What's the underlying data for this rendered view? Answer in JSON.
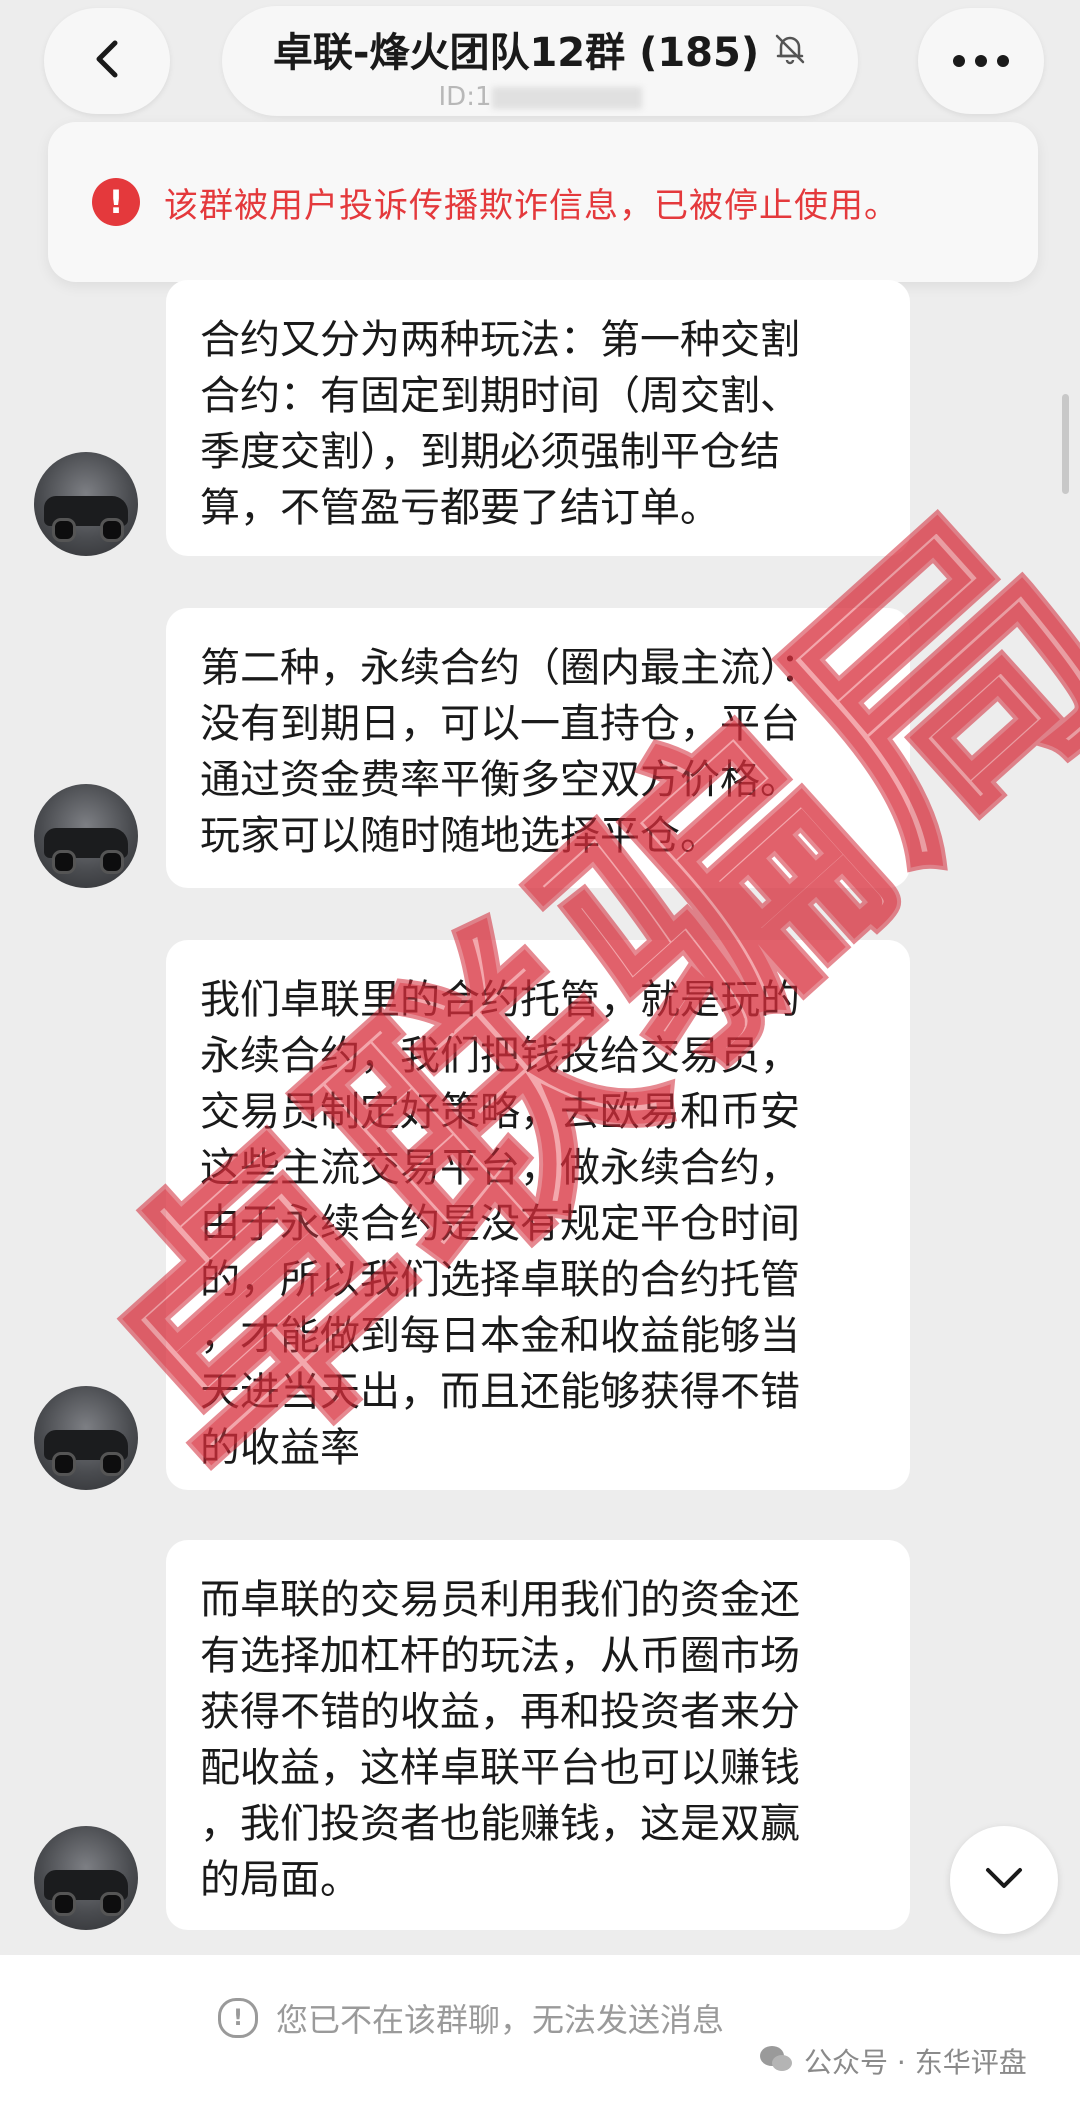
{
  "header": {
    "title": "卓联-烽火团队12群 (185)",
    "id_label": "ID:1",
    "back_icon": "chevron-left-icon",
    "mute_icon": "bell-off-icon",
    "more_icon": "more-horizontal-icon"
  },
  "warning": {
    "icon": "!",
    "text": "该群被用户投诉传播欺诈信息，已被停止使用。",
    "color": "#e4393c"
  },
  "messages": [
    {
      "lines": [
        "合约又分为两种玩法：第一种交割",
        "合约：有固定到期时间（周交割、",
        "季度交割），到期必须强制平仓结",
        "算，不管盈亏都要了结订单。"
      ]
    },
    {
      "lines": [
        "第二种，永续合约（圈内最主流）：",
        "没有到期日，可以一直持仓，平台",
        "通过资金费率平衡多空双方价格。",
        "玩家可以随时随地选择平仓。"
      ]
    },
    {
      "lines": [
        "我们卓联里的合约托管，就是玩的",
        "永续合约，我们把钱投给交易员，",
        "交易员制定好策略，去欧易和币安",
        "这些主流交易平台，做永续合约，",
        "由于永续合约是没有规定平仓时间",
        "的，所以我们选择卓联的合约托管",
        "，才能做到每日本金和收益能够当",
        "天进当天出，而且还能够获得不错",
        "的收益率"
      ]
    },
    {
      "lines": [
        "而卓联的交易员利用我们的资金还",
        "有选择加杠杆的玩法，从币圈市场",
        "获得不错的收益，再和投资者来分",
        "配收益，这样卓联平台也可以赚钱",
        "，我们投资者也能赚钱，这是双赢",
        "的局面。"
      ]
    }
  ],
  "bottom": {
    "notice_icon": "!",
    "notice_text": "您已不在该群聊，无法发送消息",
    "source_text": "公众号 · 东华评盘"
  },
  "watermark": {
    "text": "卓联骗局"
  }
}
